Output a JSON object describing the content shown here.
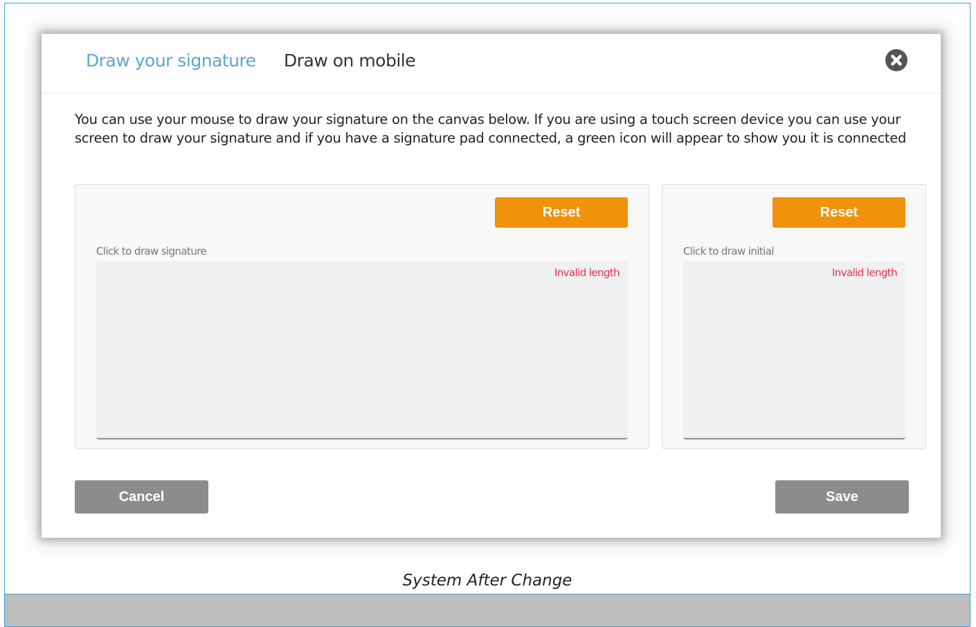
{
  "modal": {
    "tabs": [
      {
        "label": "Draw your signature",
        "active": true
      },
      {
        "label": "Draw on mobile",
        "active": false
      }
    ],
    "close_icon": "close-circle-icon",
    "instructions": "You can use your mouse to draw your signature on the canvas below. If you are using a touch screen device you can use your screen to draw your signature and if you have a signature pad connected, a green icon will appear to show you it is connected",
    "signature_panel": {
      "reset_label": "Reset",
      "canvas_label": "Click to draw signature",
      "error": "Invalid length"
    },
    "initial_panel": {
      "reset_label": "Reset",
      "canvas_label": "Click to draw initial",
      "error": "Invalid length"
    },
    "footer": {
      "cancel_label": "Cancel",
      "save_label": "Save"
    }
  },
  "caption": "System After Change",
  "colors": {
    "tab_active": "#5aa6cf",
    "reset_button": "#f0920b",
    "error_text": "#e2334f",
    "footer_button": "#8c8c8c",
    "frame_border": "#3aa0d0"
  }
}
